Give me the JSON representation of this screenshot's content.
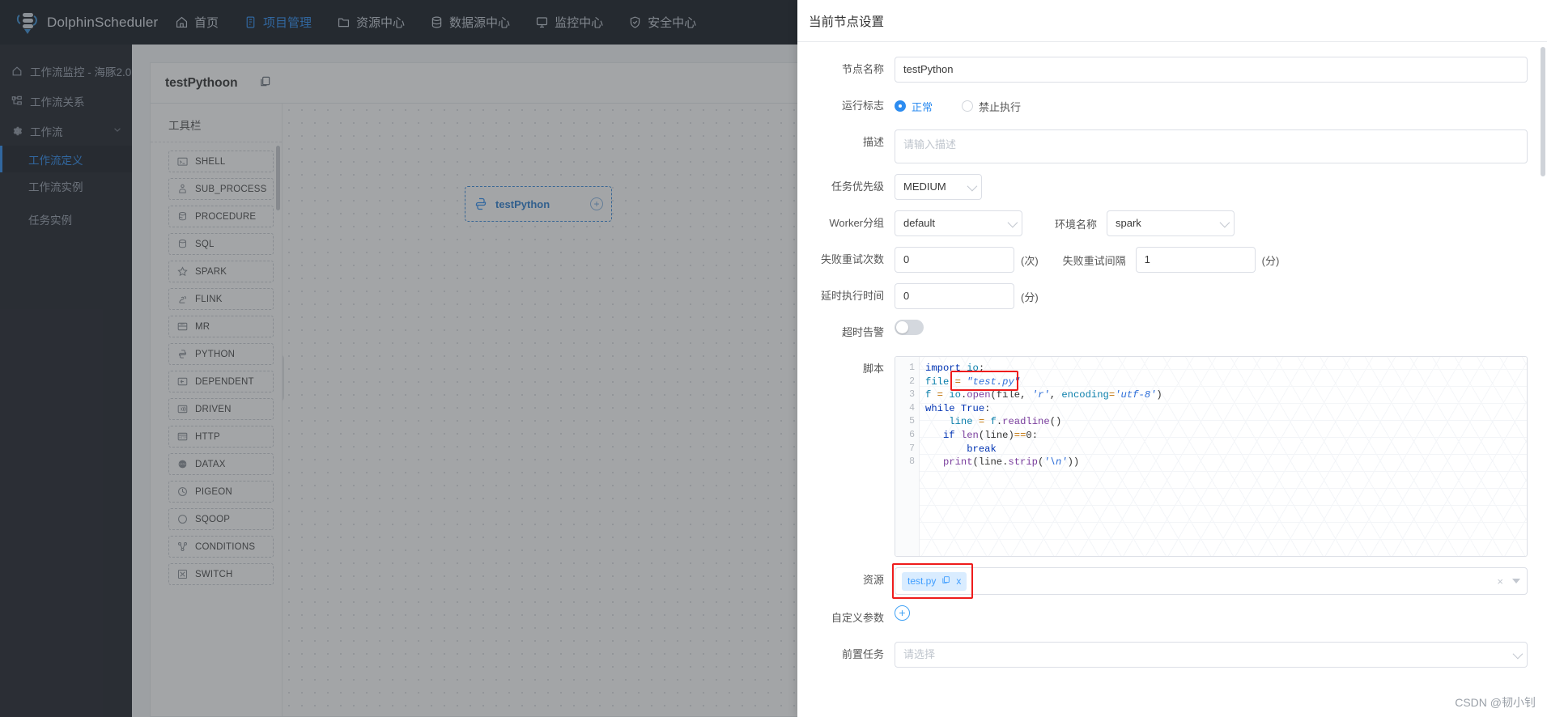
{
  "topnav": {
    "brand": "DolphinScheduler",
    "items": [
      {
        "label": "首页",
        "icon": "home-icon",
        "active": false
      },
      {
        "label": "项目管理",
        "icon": "project-icon",
        "active": true
      },
      {
        "label": "资源中心",
        "icon": "folder-icon",
        "active": false
      },
      {
        "label": "数据源中心",
        "icon": "database-icon",
        "active": false
      },
      {
        "label": "监控中心",
        "icon": "monitor-icon",
        "active": false
      },
      {
        "label": "安全中心",
        "icon": "shield-check-icon",
        "active": false
      }
    ]
  },
  "sidebar": {
    "items": [
      {
        "label": "工作流监控 - 海豚2.0",
        "icon": "home-icon"
      },
      {
        "label": "工作流关系",
        "icon": "relation-icon"
      },
      {
        "label": "工作流",
        "icon": "gear-icon",
        "expanded": true
      }
    ],
    "subitems": [
      {
        "label": "工作流定义",
        "active": true
      },
      {
        "label": "工作流实例",
        "active": false
      },
      {
        "label": "任务实例",
        "active": false
      }
    ]
  },
  "workflow": {
    "title": "testPythoon",
    "copy_icon": "copy-icon"
  },
  "toolbar": {
    "title": "工具栏",
    "items": [
      {
        "label": "SHELL",
        "icon": "terminal-icon"
      },
      {
        "label": "SUB_PROCESS",
        "icon": "subprocess-icon"
      },
      {
        "label": "PROCEDURE",
        "icon": "procedure-icon"
      },
      {
        "label": "SQL",
        "icon": "sql-icon"
      },
      {
        "label": "SPARK",
        "icon": "star-icon"
      },
      {
        "label": "FLINK",
        "icon": "squirrel-icon"
      },
      {
        "label": "MR",
        "icon": "mr-icon"
      },
      {
        "label": "PYTHON",
        "icon": "python-icon"
      },
      {
        "label": "DEPENDENT",
        "icon": "dependent-icon"
      },
      {
        "label": "DRIVEN",
        "icon": "driven-icon"
      },
      {
        "label": "HTTP",
        "icon": "http-icon"
      },
      {
        "label": "DATAX",
        "icon": "datax-icon"
      },
      {
        "label": "PIGEON",
        "icon": "pigeon-icon"
      },
      {
        "label": "SQOOP",
        "icon": "sqoop-icon"
      },
      {
        "label": "CONDITIONS",
        "icon": "conditions-icon"
      },
      {
        "label": "SWITCH",
        "icon": "switch-icon"
      }
    ]
  },
  "canvas": {
    "node_label": "testPython",
    "node_icon": "python-icon",
    "node_add": "+",
    "collapse_handle": "‹"
  },
  "modal": {
    "title": "当前节点设置",
    "node_name": {
      "label": "节点名称",
      "value": "testPython"
    },
    "run_flag": {
      "label": "运行标志",
      "options": [
        {
          "label": "正常",
          "selected": true
        },
        {
          "label": "禁止执行",
          "selected": false
        }
      ]
    },
    "description": {
      "label": "描述",
      "placeholder": "请输入描述",
      "value": ""
    },
    "task_priority": {
      "label": "任务优先级",
      "value": "MEDIUM"
    },
    "worker_group": {
      "label": "Worker分组",
      "value": "default"
    },
    "environment_name": {
      "label": "环境名称",
      "value": "spark"
    },
    "fail_retry_times": {
      "label": "失败重试次数",
      "value": "0",
      "unit": "(次)"
    },
    "fail_retry_interval": {
      "label": "失败重试间隔",
      "value": "1",
      "unit": "(分)"
    },
    "delay_exec_time": {
      "label": "延时执行时间",
      "value": "0",
      "unit": "(分)"
    },
    "timeout_alarm": {
      "label": "超时告警",
      "enabled": false
    },
    "script": {
      "label": "脚本",
      "lines": [
        {
          "no": "1",
          "tokens": [
            [
              "k",
              "import"
            ],
            [
              "pl",
              " "
            ],
            [
              "nm",
              "io"
            ],
            [
              "pl",
              ";"
            ]
          ]
        },
        {
          "no": "2",
          "tokens": [
            [
              "nm",
              "file"
            ],
            [
              "pl",
              " "
            ],
            [
              "op",
              "="
            ],
            [
              "pl",
              " "
            ],
            [
              "st2",
              "\"test.py\""
            ]
          ]
        },
        {
          "no": "3",
          "tokens": [
            [
              "nm",
              "f"
            ],
            [
              "pl",
              " "
            ],
            [
              "op",
              "="
            ],
            [
              "pl",
              " "
            ],
            [
              "nm",
              "io"
            ],
            [
              "pl",
              "."
            ],
            [
              "fn",
              "open"
            ],
            [
              "pl",
              "(file, "
            ],
            [
              "st2",
              "'r'"
            ],
            [
              "pl",
              ", "
            ],
            [
              "nm",
              "encoding"
            ],
            [
              "op",
              "="
            ],
            [
              "st2",
              "'utf-8'"
            ],
            [
              "pl",
              ")"
            ]
          ]
        },
        {
          "no": "4",
          "tokens": [
            [
              "k",
              "while"
            ],
            [
              "pl",
              " "
            ],
            [
              "k",
              "True"
            ],
            [
              "pl",
              ":"
            ]
          ]
        },
        {
          "no": "5",
          "tokens": [
            [
              "pl",
              "    "
            ],
            [
              "nm",
              "line"
            ],
            [
              "pl",
              " "
            ],
            [
              "op",
              "="
            ],
            [
              "pl",
              " "
            ],
            [
              "nm",
              "f"
            ],
            [
              "pl",
              "."
            ],
            [
              "fn",
              "readline"
            ],
            [
              "pl",
              "()"
            ]
          ]
        },
        {
          "no": "6",
          "tokens": [
            [
              "pl",
              "   "
            ],
            [
              "k",
              "if"
            ],
            [
              "pl",
              " "
            ],
            [
              "fn",
              "len"
            ],
            [
              "pl",
              "(line)"
            ],
            [
              "op",
              "=="
            ],
            [
              "pl",
              "0:"
            ]
          ]
        },
        {
          "no": "7",
          "tokens": [
            [
              "pl",
              "       "
            ],
            [
              "k",
              "break"
            ]
          ]
        },
        {
          "no": "8",
          "tokens": [
            [
              "pl",
              "   "
            ],
            [
              "fn",
              "print"
            ],
            [
              "pl",
              "(line."
            ],
            [
              "fn",
              "strip"
            ],
            [
              "pl",
              "("
            ],
            [
              "st2",
              "'\\n'"
            ],
            [
              "pl",
              "))"
            ]
          ]
        }
      ]
    },
    "resource": {
      "label": "资源",
      "tag": "test.py",
      "copy_icon": "copy-icon",
      "remove": "x",
      "clear": "×"
    },
    "custom_params": {
      "label": "自定义参数",
      "add": "+"
    },
    "pre_task": {
      "label": "前置任务",
      "placeholder": "请选择"
    }
  },
  "watermark": "CSDN @韧小钊"
}
